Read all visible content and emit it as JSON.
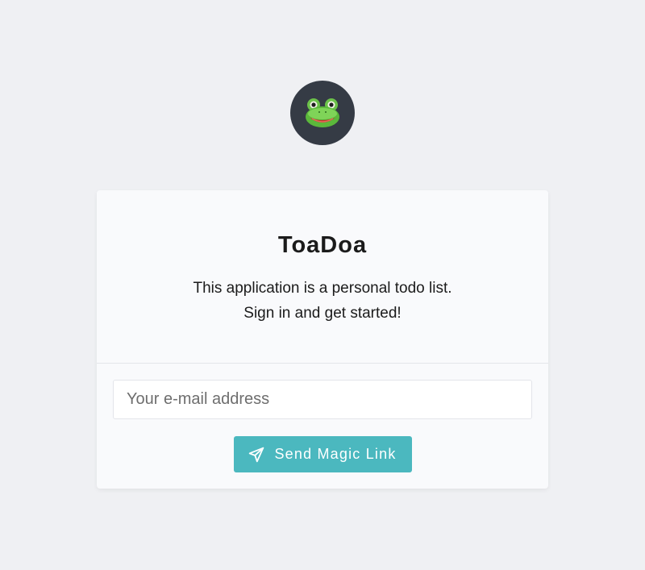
{
  "logo": {
    "icon": "frog-face-icon",
    "background": "#353b45"
  },
  "card": {
    "title": "ToaDoa",
    "description_line1": "This application is a personal todo list.",
    "description_line2": "Sign in and get started!"
  },
  "form": {
    "email_placeholder": "Your e-mail address",
    "email_value": "",
    "send_label": "Send Magic Link",
    "send_icon": "paper-plane-icon",
    "button_color": "#4bb8bf"
  }
}
